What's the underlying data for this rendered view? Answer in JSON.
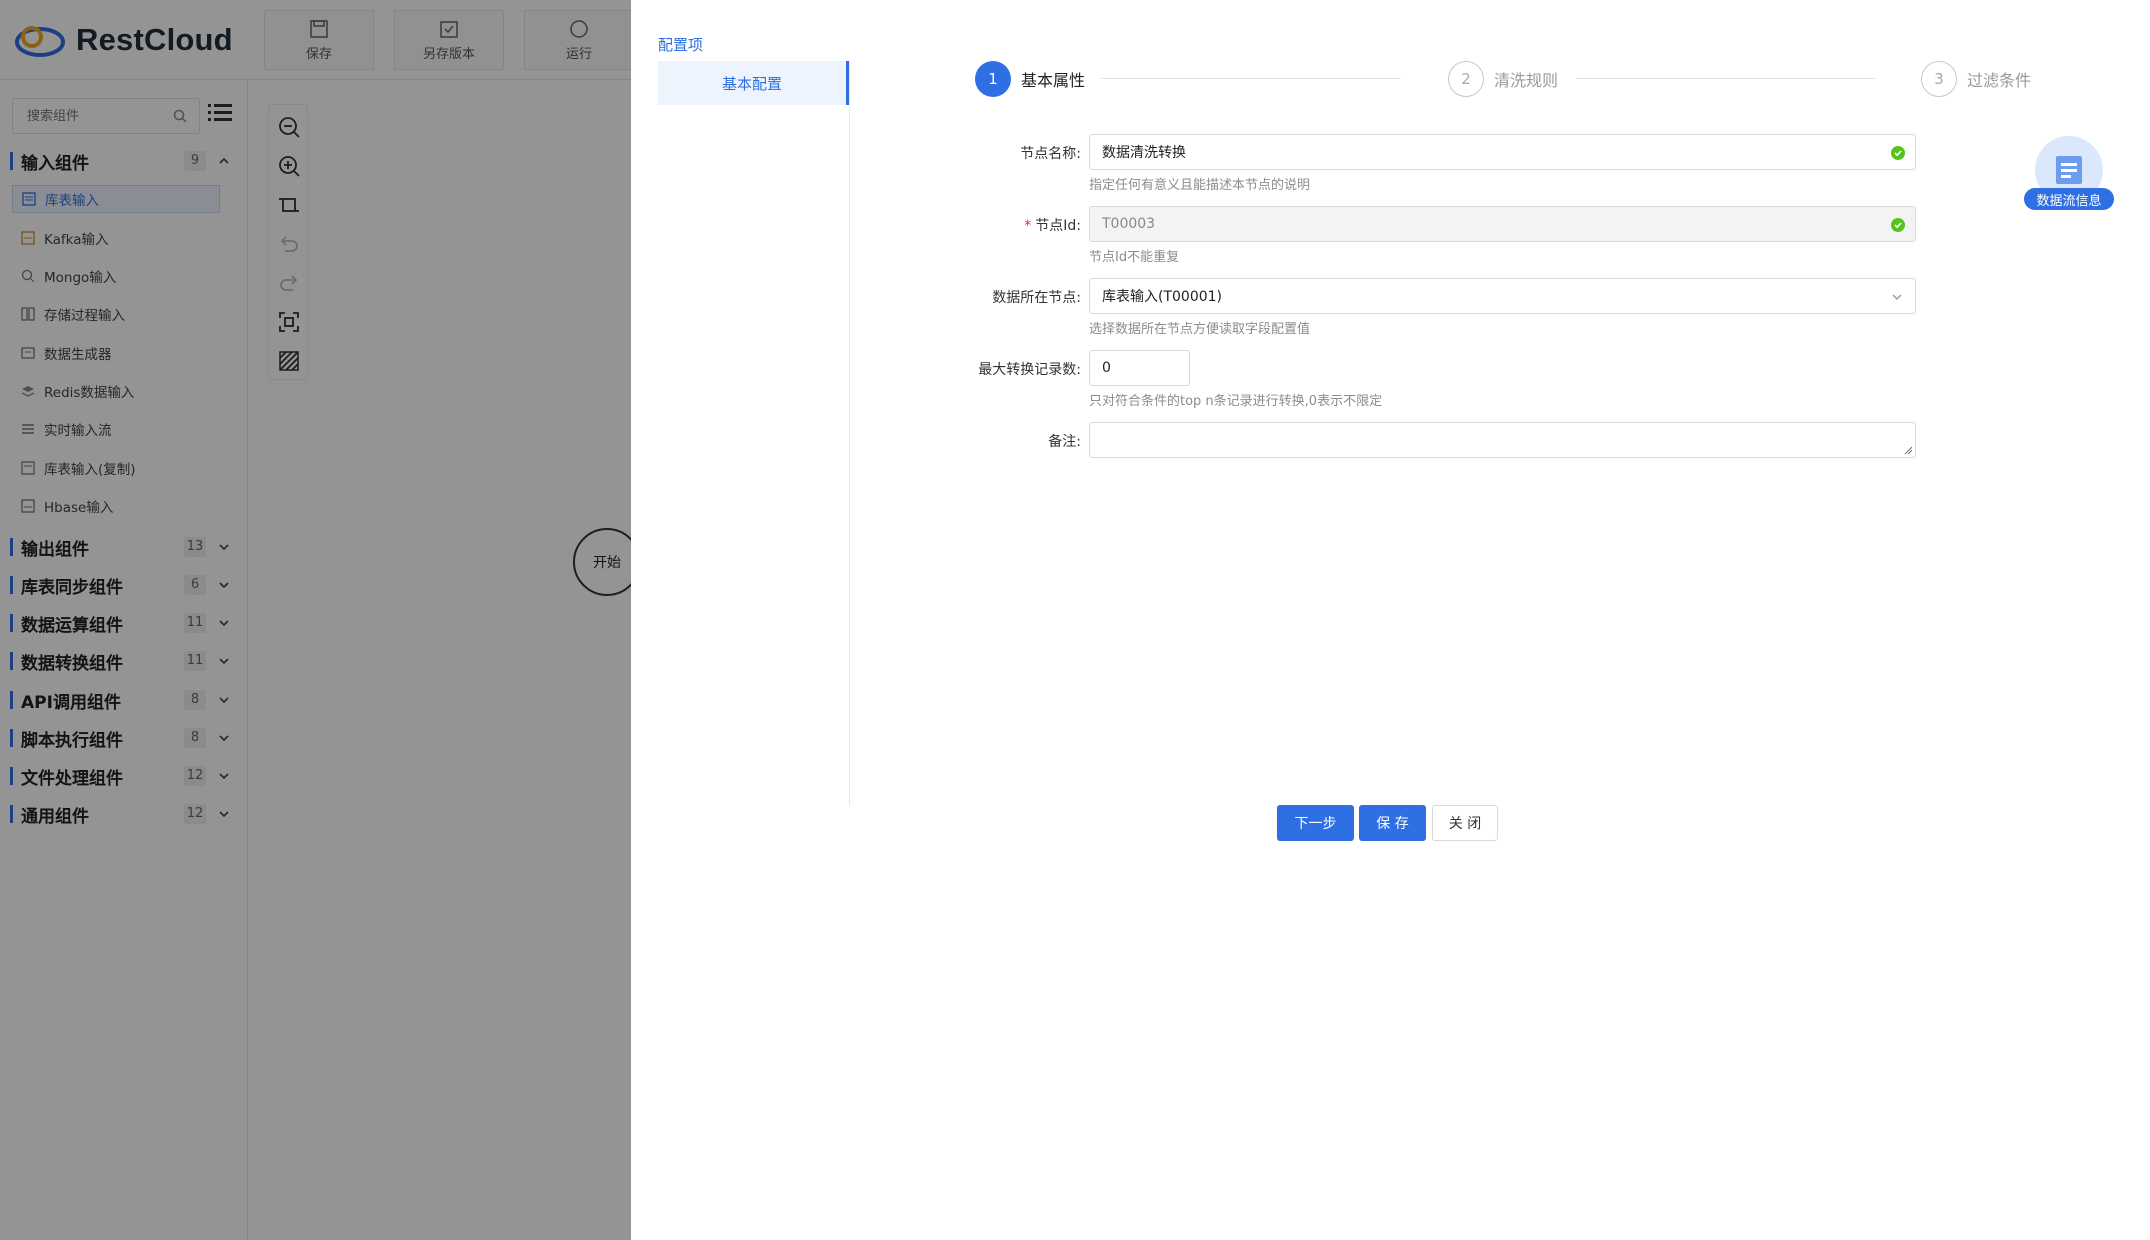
{
  "app": {
    "brand": "RestCloud",
    "toolbar": [
      {
        "label": "保存",
        "icon": "save-icon"
      },
      {
        "label": "另存版本",
        "icon": "save-version-icon"
      },
      {
        "label": "运行",
        "icon": "run-icon"
      }
    ]
  },
  "sidebar": {
    "search_placeholder": "搜索组件",
    "categories": [
      {
        "label": "输入组件",
        "count": "9",
        "expanded": true
      },
      {
        "label": "输出组件",
        "count": "13"
      },
      {
        "label": "库表同步组件",
        "count": "6"
      },
      {
        "label": "数据运算组件",
        "count": "11"
      },
      {
        "label": "数据转换组件",
        "count": "11"
      },
      {
        "label": "API调用组件",
        "count": "8"
      },
      {
        "label": "脚本执行组件",
        "count": "8"
      },
      {
        "label": "文件处理组件",
        "count": "12"
      },
      {
        "label": "通用组件",
        "count": "12"
      }
    ],
    "input_items": [
      "库表输入",
      "Kafka输入",
      "Mongo输入",
      "存储过程输入",
      "数据生成器",
      "Redis数据输入",
      "实时输入流",
      "库表输入(复制)",
      "Hbase输入"
    ]
  },
  "canvas": {
    "start_node": "开始"
  },
  "drawer": {
    "nav_title": "配置项",
    "nav_item": "基本配置",
    "steps": [
      {
        "num": "1",
        "title": "基本属性",
        "state": "current"
      },
      {
        "num": "2",
        "title": "清洗规则",
        "state": "todo"
      },
      {
        "num": "3",
        "title": "过滤条件",
        "state": "todo"
      }
    ],
    "form": {
      "node_name": {
        "label": "节点名称:",
        "value": "数据清洗转换",
        "help": "指定任何有意义且能描述本节点的说明"
      },
      "node_id": {
        "label": "节点Id:",
        "value": "T00003",
        "help": "节点Id不能重复"
      },
      "data_node": {
        "label": "数据所在节点:",
        "value": "库表输入(T00001)",
        "help": "选择数据所在节点方便读取字段配置值"
      },
      "max_records": {
        "label": "最大转换记录数:",
        "value": "0",
        "help": "只对符合条件的top n条记录进行转换,0表示不限定"
      },
      "remark": {
        "label": "备注:",
        "value": ""
      }
    },
    "buttons": {
      "next": "下一步",
      "save": "保 存",
      "close": "关 闭"
    },
    "flow_info": "数据流信息"
  },
  "colors": {
    "accent": "#2f6fe4",
    "success": "#52c41a",
    "required": "#f5222d"
  }
}
